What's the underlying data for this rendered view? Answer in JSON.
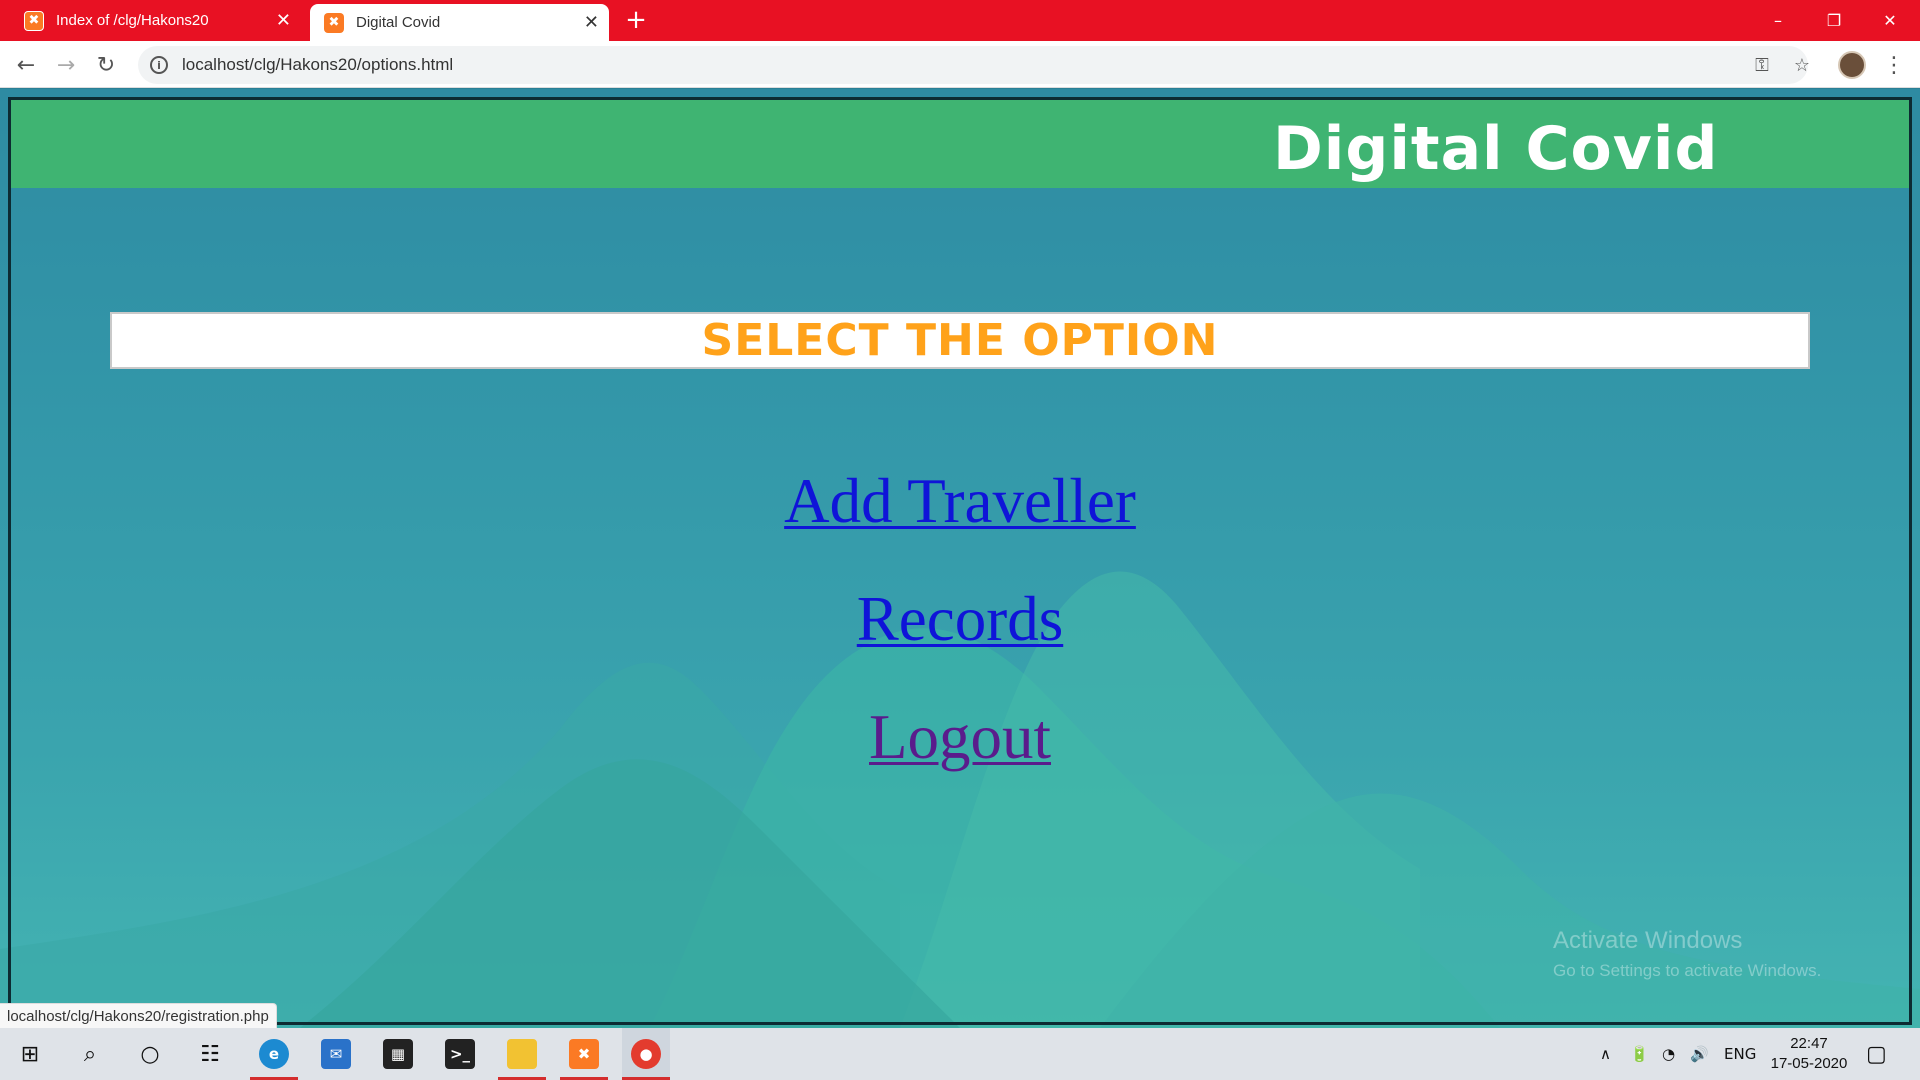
{
  "browser": {
    "tabs": [
      {
        "title": "Index of /clg/Hakons20",
        "active": false
      },
      {
        "title": "Digital Covid",
        "active": true
      }
    ],
    "address_url": "localhost/clg/Hakons20/options.html",
    "status_url": "localhost/clg/Hakons20/registration.php"
  },
  "page": {
    "site_title": "Digital Covid",
    "select_heading": "SELECT THE OPTION",
    "links": [
      {
        "label": "Add Traveller"
      },
      {
        "label": "Records"
      },
      {
        "label": "Logout"
      }
    ],
    "colors": {
      "header_bg": "#3fb472",
      "heading_text": "#ffa21a",
      "link": "#0f14d8",
      "visited_link": "#5a1c8c"
    }
  },
  "watermark": {
    "line1": "Activate Windows",
    "line2": "Go to Settings to activate Windows."
  },
  "taskbar": {
    "language": "ENG",
    "time": "22:47",
    "date": "17-05-2020"
  }
}
